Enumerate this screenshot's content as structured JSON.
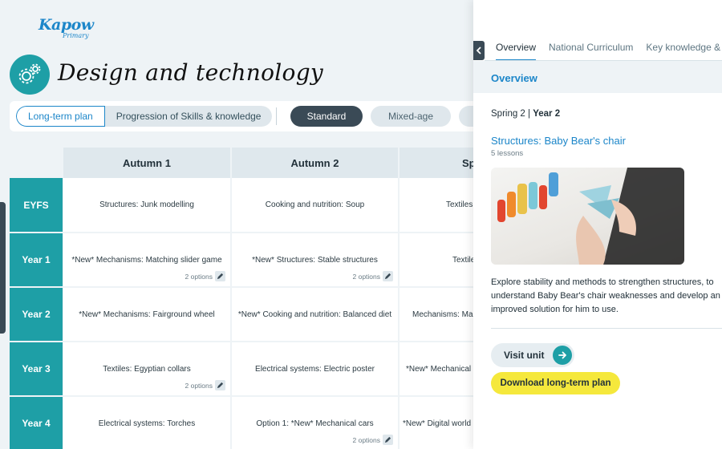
{
  "brand": {
    "logo_main": "Kapow",
    "logo_sub": "Primary"
  },
  "page": {
    "title": "Design and technology",
    "icon": "gears-icon"
  },
  "toolbar": {
    "tab_long_term": "Long-term plan",
    "tab_progression": "Progression of Skills & knowledge",
    "standard_label": "Standard",
    "mixed_age_label": "Mixed-age"
  },
  "grid": {
    "columns": [
      "Autumn 1",
      "Autumn 2",
      "Sp"
    ],
    "rows": [
      {
        "label": "EYFS",
        "cells": [
          "Structures: Junk modelling",
          "Cooking and nutrition: Soup",
          "Textiles"
        ],
        "options": [
          "",
          "",
          ""
        ]
      },
      {
        "label": "Year 1",
        "cells": [
          "*New* Mechanisms: Matching slider game",
          "*New* Structures: Stable structures",
          "Textile"
        ],
        "options": [
          "2 options",
          "2 options",
          ""
        ]
      },
      {
        "label": "Year 2",
        "cells": [
          "*New* Mechanisms: Fairground wheel",
          "*New* Cooking and nutrition: Balanced diet",
          "Mechanisms: Mal"
        ],
        "options": [
          "",
          "",
          ""
        ]
      },
      {
        "label": "Year 3",
        "cells": [
          "Textiles: Egyptian collars",
          "Electrical systems: Electric poster",
          "*New* Mechanical"
        ],
        "options": [
          "2 options",
          "",
          ""
        ]
      },
      {
        "label": "Year 4",
        "cells": [
          "Electrical systems: Torches",
          "Option 1: *New* Mechanical cars",
          "*New* Digital world"
        ],
        "options": [
          "",
          "2 options",
          ""
        ]
      }
    ]
  },
  "panel": {
    "tabs": [
      "Overview",
      "National Curriculum",
      "Key knowledge & skil"
    ],
    "section_title": "Overview",
    "term": "Spring 2",
    "separator": " | ",
    "year": "Year 2",
    "unit_title": "Structures: Baby Bear's chair",
    "lessons": "5 lessons",
    "description": [
      "Explore stability and methods to strengthen structures, to",
      "understand Baby Bear's chair weaknesses and develop an",
      "improved solution for him to use."
    ],
    "visit_label": "Visit unit",
    "download_label": "Download long-term plan"
  },
  "colors": {
    "teal": "#1e9fa6",
    "blue": "#1c86c9",
    "dark": "#3a4a56",
    "yellow": "#f5e83c"
  }
}
